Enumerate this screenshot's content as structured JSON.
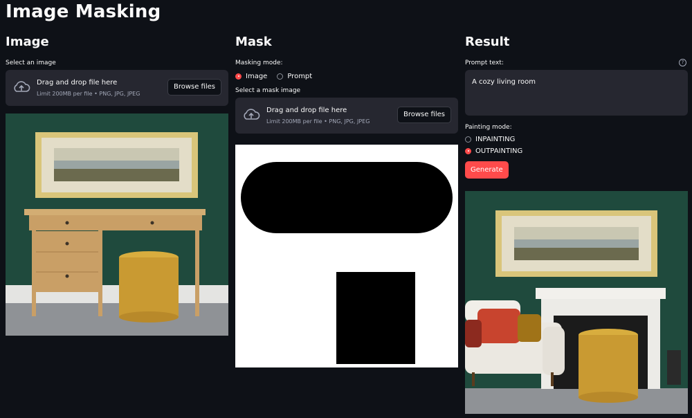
{
  "app": {
    "title": "Image Masking"
  },
  "image_col": {
    "heading": "Image",
    "select_label": "Select an image",
    "uploader": {
      "main": "Drag and drop file here",
      "sub": "Limit 200MB per file • PNG, JPG, JPEG",
      "button": "Browse files"
    }
  },
  "mask_col": {
    "heading": "Mask",
    "mode_label": "Masking mode:",
    "mode_options": [
      "Image",
      "Prompt"
    ],
    "mode_selected": "Image",
    "select_label": "Select a mask image",
    "uploader": {
      "main": "Drag and drop file here",
      "sub": "Limit 200MB per file • PNG, JPG, JPEG",
      "button": "Browse files"
    }
  },
  "result_col": {
    "heading": "Result",
    "prompt_label": "Prompt text:",
    "prompt_value": "A cozy living room",
    "painting_label": "Painting mode:",
    "painting_options": [
      "INPAINTING",
      "OUTPAINTING"
    ],
    "painting_selected": "OUTPAINTING",
    "generate": "Generate"
  },
  "icons": {
    "upload": "cloud-upload-icon",
    "help": "question-circle-icon"
  },
  "colors": {
    "accent": "#ff4b4b",
    "background": "#0e1117",
    "widget": "#262730",
    "wall": "#1f4a3d"
  }
}
